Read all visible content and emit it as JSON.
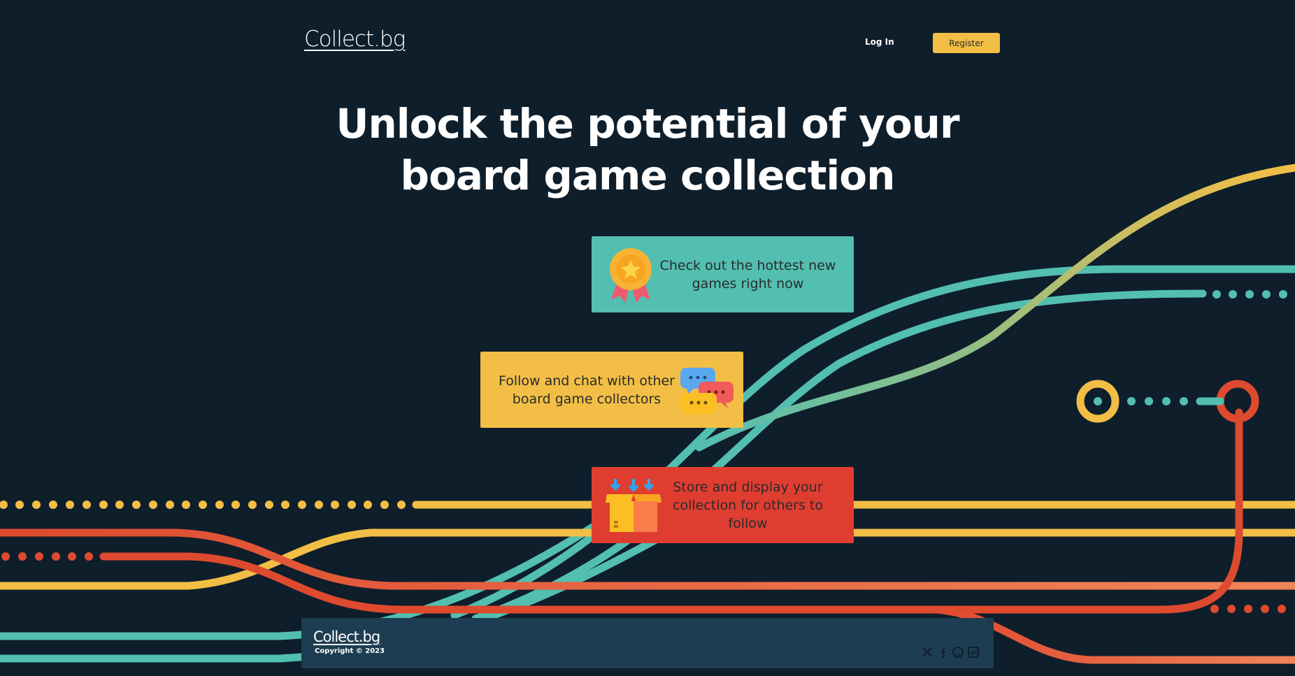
{
  "header": {
    "logo": "Collect.bg",
    "login_label": "Log In",
    "register_label": "Register"
  },
  "hero": {
    "title": "Unlock the potential of your board game collection"
  },
  "features": [
    {
      "text": "Check out the hottest new games right now",
      "icon": "medal-icon"
    },
    {
      "text": "Follow and chat with other board game collectors",
      "icon": "chat-bubbles-icon"
    },
    {
      "text": "Store and display your collection for others to follow",
      "icon": "box-icon"
    }
  ],
  "footer": {
    "logo": "Collect.bg",
    "copyright": "Copyright © 2023",
    "socials": [
      "x-icon",
      "facebook-icon",
      "github-icon",
      "linkedin-icon"
    ]
  },
  "colors": {
    "background": "#0f1e2b",
    "teal": "#52bfb0",
    "yellow": "#f2be45",
    "red": "#e03d31",
    "orange_red": "#de4a2e",
    "footer_bg": "#1d3d52"
  }
}
